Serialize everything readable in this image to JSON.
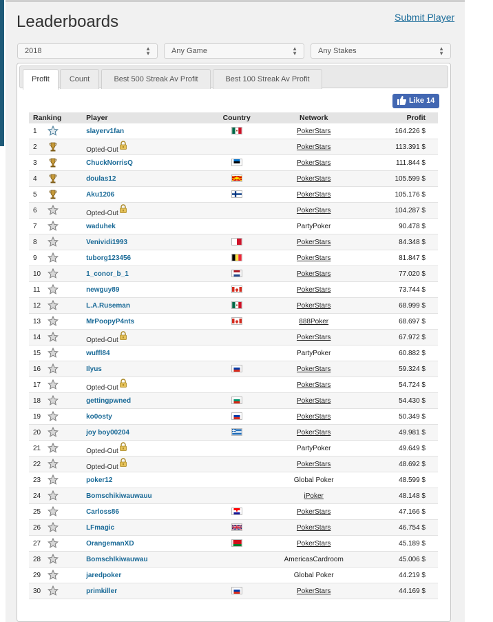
{
  "header": {
    "title": "Leaderboards",
    "submit_label": "Submit Player"
  },
  "filters": {
    "year": "2018",
    "game": "Any Game",
    "stakes": "Any Stakes"
  },
  "tabs": [
    {
      "label": "Profit",
      "active": true
    },
    {
      "label": "Count",
      "active": false
    },
    {
      "label": "Best 500 Streak Av Profit",
      "active": false
    },
    {
      "label": "Best 100 Streak Av Profit",
      "active": false
    }
  ],
  "like_button": {
    "label": "Like 14"
  },
  "table": {
    "columns": [
      "Ranking",
      "Player",
      "Country",
      "Network",
      "Profit"
    ],
    "rows": [
      {
        "rank": "1",
        "badge": "star-blue-icon",
        "player": "slayerv1fan",
        "opted": false,
        "flag": "mexico",
        "network": "PokerStars",
        "network_link": true,
        "profit": "164.226 $"
      },
      {
        "rank": "2",
        "badge": "trophy-gold-icon",
        "player": "Opted-Out",
        "opted": true,
        "flag": "",
        "network": "PokerStars",
        "network_link": true,
        "profit": "113.391 $"
      },
      {
        "rank": "3",
        "badge": "trophy-gold-icon",
        "player": "ChuckNorrisQ",
        "opted": false,
        "flag": "estonia",
        "network": "PokerStars",
        "network_link": true,
        "profit": "111.844 $"
      },
      {
        "rank": "4",
        "badge": "trophy-gold-icon",
        "player": "doulas12",
        "opted": false,
        "flag": "macedonia",
        "network": "PokerStars",
        "network_link": true,
        "profit": "105.599 $"
      },
      {
        "rank": "5",
        "badge": "trophy-gold-icon",
        "player": "Aku1206",
        "opted": false,
        "flag": "finland",
        "network": "PokerStars",
        "network_link": true,
        "profit": "105.176 $"
      },
      {
        "rank": "6",
        "badge": "star-grey-icon",
        "player": "Opted-Out",
        "opted": true,
        "flag": "",
        "network": "PokerStars",
        "network_link": true,
        "profit": "104.287 $"
      },
      {
        "rank": "7",
        "badge": "star-grey-icon",
        "player": "waduhek",
        "opted": false,
        "flag": "",
        "network": "PartyPoker",
        "network_link": false,
        "profit": "90.478 $"
      },
      {
        "rank": "8",
        "badge": "star-grey-icon",
        "player": "Venividi1993",
        "opted": false,
        "flag": "malta",
        "network": "PokerStars",
        "network_link": true,
        "profit": "84.348 $"
      },
      {
        "rank": "9",
        "badge": "star-grey-icon",
        "player": "tuborg123456",
        "opted": false,
        "flag": "belgium",
        "network": "PokerStars",
        "network_link": true,
        "profit": "81.847 $"
      },
      {
        "rank": "10",
        "badge": "star-grey-icon",
        "player": "1_conor_b_1",
        "opted": false,
        "flag": "netherlands",
        "network": "PokerStars",
        "network_link": true,
        "profit": "77.020 $"
      },
      {
        "rank": "11",
        "badge": "star-grey-icon",
        "player": "newguy89",
        "opted": false,
        "flag": "canada",
        "network": "PokerStars",
        "network_link": true,
        "profit": "73.744 $"
      },
      {
        "rank": "12",
        "badge": "star-grey-icon",
        "player": "L.A.Ruseman",
        "opted": false,
        "flag": "mexico",
        "network": "PokerStars",
        "network_link": true,
        "profit": "68.999 $"
      },
      {
        "rank": "13",
        "badge": "star-grey-icon",
        "player": "MrPoopyP4nts",
        "opted": false,
        "flag": "canada",
        "network": "888Poker",
        "network_link": true,
        "profit": "68.697 $"
      },
      {
        "rank": "14",
        "badge": "star-grey-icon",
        "player": "Opted-Out",
        "opted": true,
        "flag": "",
        "network": "PokerStars",
        "network_link": true,
        "profit": "67.972 $"
      },
      {
        "rank": "15",
        "badge": "star-grey-icon",
        "player": "wuffl84",
        "opted": false,
        "flag": "",
        "network": "PartyPoker",
        "network_link": false,
        "profit": "60.882 $"
      },
      {
        "rank": "16",
        "badge": "star-grey-icon",
        "player": "Ilyus",
        "opted": false,
        "flag": "russia",
        "network": "PokerStars",
        "network_link": true,
        "profit": "59.324 $"
      },
      {
        "rank": "17",
        "badge": "star-grey-icon",
        "player": "Opted-Out",
        "opted": true,
        "flag": "",
        "network": "PokerStars",
        "network_link": true,
        "profit": "54.724 $"
      },
      {
        "rank": "18",
        "badge": "star-grey-icon",
        "player": "gettingpwned",
        "opted": false,
        "flag": "bulgaria",
        "network": "PokerStars",
        "network_link": true,
        "profit": "54.430 $"
      },
      {
        "rank": "19",
        "badge": "star-grey-icon",
        "player": "ko0osty",
        "opted": false,
        "flag": "russia",
        "network": "PokerStars",
        "network_link": true,
        "profit": "50.349 $"
      },
      {
        "rank": "20",
        "badge": "star-grey-icon",
        "player": "joy boy00204",
        "opted": false,
        "flag": "greece",
        "network": "PokerStars",
        "network_link": true,
        "profit": "49.981 $"
      },
      {
        "rank": "21",
        "badge": "star-grey-icon",
        "player": "Opted-Out",
        "opted": true,
        "flag": "",
        "network": "PartyPoker",
        "network_link": false,
        "profit": "49.649 $"
      },
      {
        "rank": "22",
        "badge": "star-grey-icon",
        "player": "Opted-Out",
        "opted": true,
        "flag": "",
        "network": "PokerStars",
        "network_link": true,
        "profit": "48.692 $"
      },
      {
        "rank": "23",
        "badge": "star-grey-icon",
        "player": "poker12",
        "opted": false,
        "flag": "",
        "network": "Global Poker",
        "network_link": false,
        "profit": "48.599 $"
      },
      {
        "rank": "24",
        "badge": "star-grey-icon",
        "player": "Bomschikiwauwauu",
        "opted": false,
        "flag": "",
        "network": "iPoker",
        "network_link": true,
        "profit": "48.148 $"
      },
      {
        "rank": "25",
        "badge": "star-grey-icon",
        "player": "Carloss86",
        "opted": false,
        "flag": "croatia",
        "network": "PokerStars",
        "network_link": true,
        "profit": "47.166 $"
      },
      {
        "rank": "26",
        "badge": "star-grey-icon",
        "player": "LFmagic",
        "opted": false,
        "flag": "uk",
        "network": "PokerStars",
        "network_link": true,
        "profit": "46.754 $"
      },
      {
        "rank": "27",
        "badge": "star-grey-icon",
        "player": "OrangemanXD",
        "opted": false,
        "flag": "belarus",
        "network": "PokerStars",
        "network_link": true,
        "profit": "45.189 $"
      },
      {
        "rank": "28",
        "badge": "star-grey-icon",
        "player": "BomschIkiwauwau",
        "opted": false,
        "flag": "",
        "network": "AmericasCardroom",
        "network_link": false,
        "profit": "45.006 $"
      },
      {
        "rank": "29",
        "badge": "star-grey-icon",
        "player": "jaredpoker",
        "opted": false,
        "flag": "",
        "network": "Global Poker",
        "network_link": false,
        "profit": "44.219 $"
      },
      {
        "rank": "30",
        "badge": "star-grey-icon",
        "player": "primkiller",
        "opted": false,
        "flag": "russia",
        "network": "PokerStars",
        "network_link": true,
        "profit": "44.169 $"
      }
    ]
  },
  "colors": {
    "link_blue": "#1a6a97",
    "facebook_blue": "#4267b2",
    "panel_bg": "#f1f1f1"
  }
}
